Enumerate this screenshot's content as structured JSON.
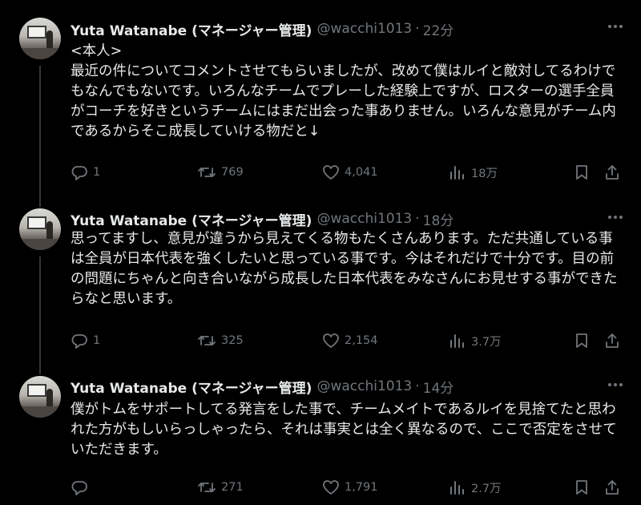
{
  "tweets": [
    {
      "name": "Yuta Watanabe (マネージャー管理)",
      "handle": "@wacchi1013",
      "time": "22分",
      "text": "<本人>\n最近の件についてコメントさせてもらいましたが、改めて僕はルイと敵対してるわけでもなんでもないです。いろんなチームでプレーした経験上ですが、ロスターの選手全員がコーチを好きというチームにはまだ出会った事ありません。いろんな意見がチーム内であるからそこ成長していける物だと↓",
      "replies": "1",
      "retweets": "769",
      "likes": "4,041",
      "views": "18万"
    },
    {
      "name": "Yuta Watanabe (マネージャー管理)",
      "handle": "@wacchi1013",
      "time": "18分",
      "text": "思ってますし、意見が違うから見えてくる物もたくさんあります。ただ共通している事は全員が日本代表を強くしたいと思っている事です。今はそれだけで十分です。目の前の問題にちゃんと向き合いながら成長した日本代表をみなさんにお見せする事ができたらなと思います。",
      "replies": "1",
      "retweets": "325",
      "likes": "2,154",
      "views": "3.7万"
    },
    {
      "name": "Yuta Watanabe (マネージャー管理)",
      "handle": "@wacchi1013",
      "time": "14分",
      "text": "僕がトムをサポートしてる発言をした事で、チームメイトであるルイを見捨てたと思われた方がもしいらっしゃったら、それは事実とは全く異なるので、ここで否定をさせていただきます。",
      "replies": "",
      "retweets": "271",
      "likes": "1,791",
      "views": "2.7万"
    }
  ],
  "icons": {
    "reply": "reply-icon",
    "retweet": "retweet-icon",
    "like": "heart-icon",
    "views": "views-icon",
    "bookmark": "bookmark-icon",
    "share": "share-icon",
    "more": "more-icon"
  },
  "colors": {
    "background": "#000000",
    "text": "#e7e9ea",
    "secondary": "#71767b",
    "thread_line": "#333639"
  }
}
